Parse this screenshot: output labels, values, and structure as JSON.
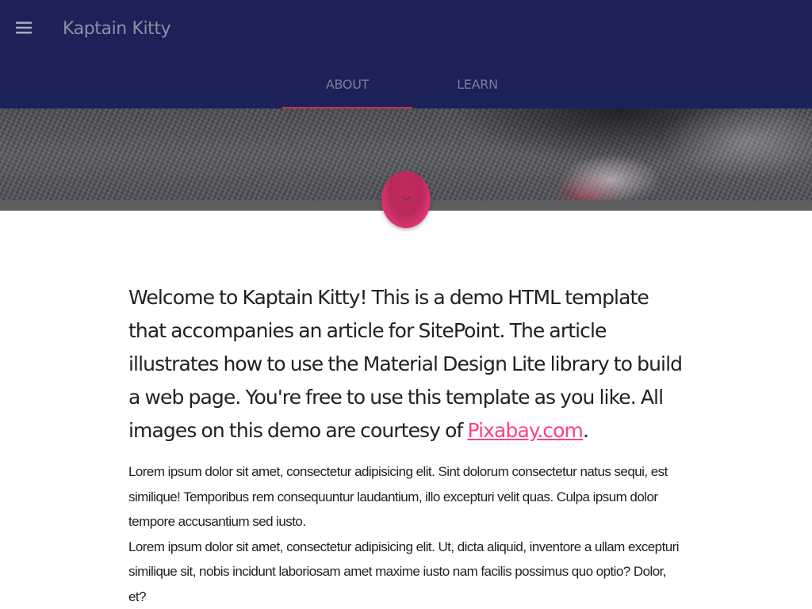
{
  "header": {
    "title": "Kaptain Kitty",
    "menu_icon": "hamburger-menu-icon",
    "background": "#1c2157"
  },
  "tabs": [
    {
      "label": "ABOUT",
      "active": true
    },
    {
      "label": "LEARN",
      "active": false
    }
  ],
  "hero": {
    "fab_icon": "chevron-down-icon",
    "fab_color": "#ff4081"
  },
  "main": {
    "lead": {
      "text": "Welcome to Kaptain Kitty! This is a demo HTML template that accompanies an article for SitePoint. The article illustrates how to use the Material Design Lite library to build a web page. You're free to use this template as you like. All images on this demo are courtesy of ",
      "link_text": "Pixabay.com",
      "suffix": "."
    },
    "paragraphs": [
      "Lorem ipsum dolor sit amet, consectetur adipisicing elit. Sint dolorum consectetur natus sequi, est similique! Temporibus rem consequuntur laudantium, illo excepturi velit quas. Culpa ipsum dolor tempore accusantium sed iusto.",
      "Lorem ipsum dolor sit amet, consectetur adipisicing elit. Ut, dicta aliquid, inventore a ullam excepturi similique sit, nobis incidunt laboriosam amet maxime iusto nam facilis possimus quo optio? Dolor, et?"
    ],
    "accent": "#ff4081"
  }
}
